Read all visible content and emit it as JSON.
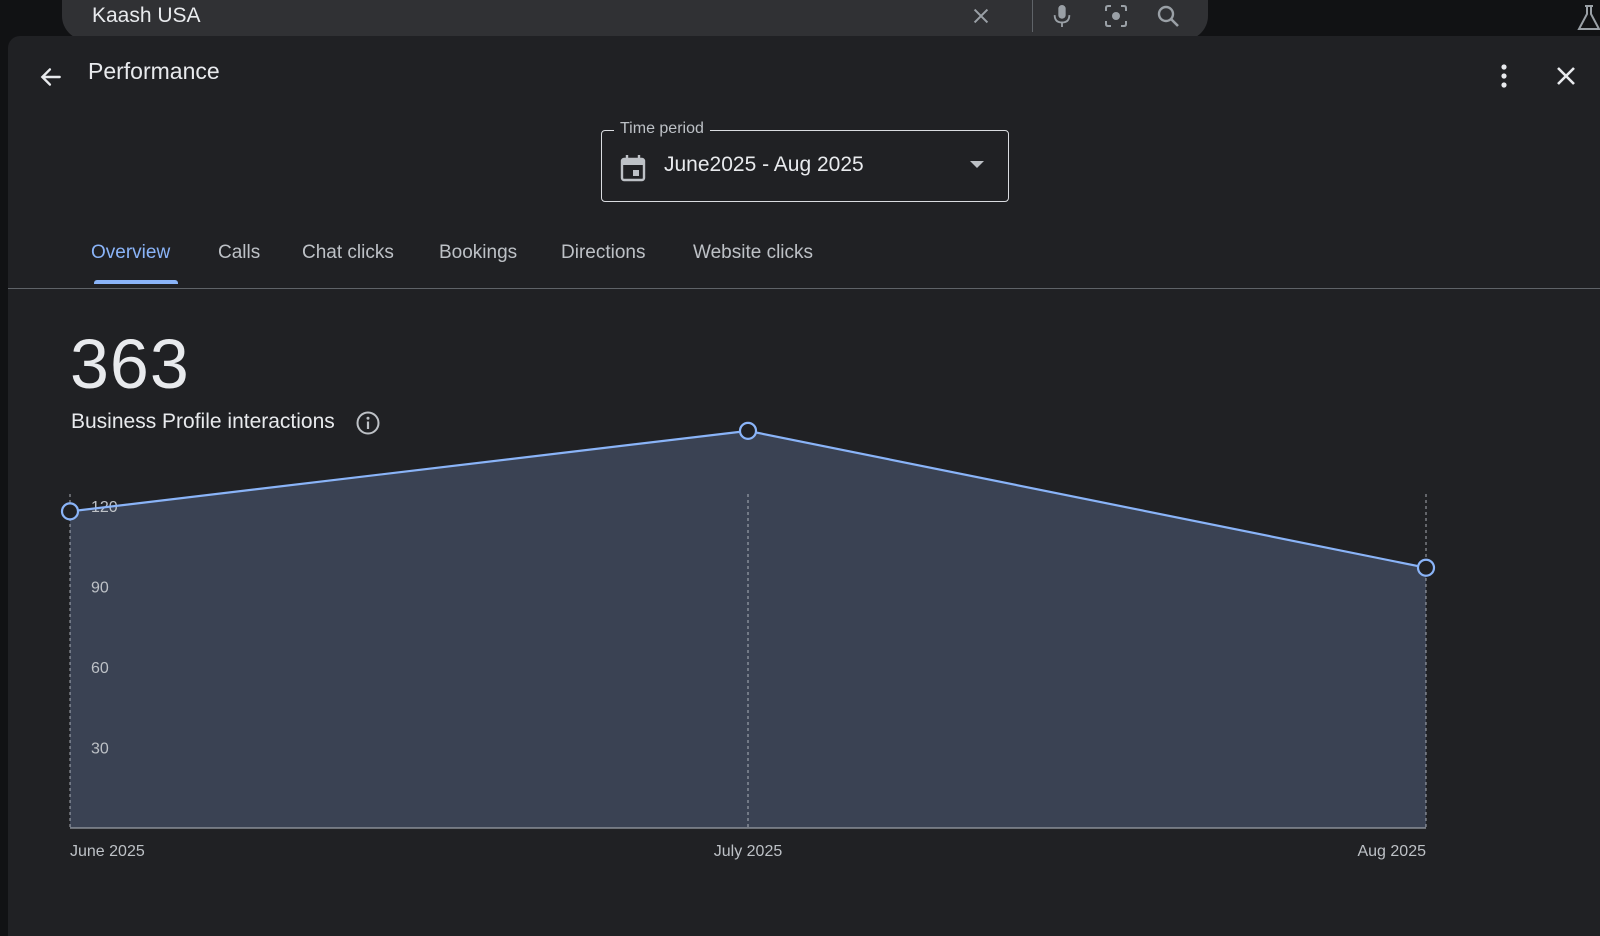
{
  "search": {
    "query": "Kaash USA",
    "icons": [
      "close-icon",
      "microphone-icon",
      "camera-search-icon",
      "search-icon"
    ]
  },
  "header": {
    "title": "Performance",
    "back_icon": "arrow-back-icon",
    "more_icon": "more-vert-icon",
    "close_icon": "close-icon"
  },
  "time_period": {
    "label": "Time period",
    "value": "June2025 - Aug 2025",
    "icon": "calendar-icon"
  },
  "tabs": [
    {
      "label": "Overview",
      "active": true
    },
    {
      "label": "Calls",
      "active": false
    },
    {
      "label": "Chat clicks",
      "active": false
    },
    {
      "label": "Bookings",
      "active": false
    },
    {
      "label": "Directions",
      "active": false
    },
    {
      "label": "Website clicks",
      "active": false
    }
  ],
  "metric": {
    "total": "363",
    "label": "Business Profile interactions",
    "info_icon": "info-icon"
  },
  "colors": {
    "accent": "#8ab4f8",
    "area_fill": "#3c4556",
    "panel_bg": "#202124"
  },
  "chart_data": {
    "type": "area",
    "categories": [
      "June 2025",
      "July 2025",
      "Aug 2025"
    ],
    "values": [
      118,
      148,
      97
    ],
    "ylim": [
      0,
      120
    ],
    "yticks": [
      30,
      60,
      90,
      120
    ],
    "grid": false
  }
}
